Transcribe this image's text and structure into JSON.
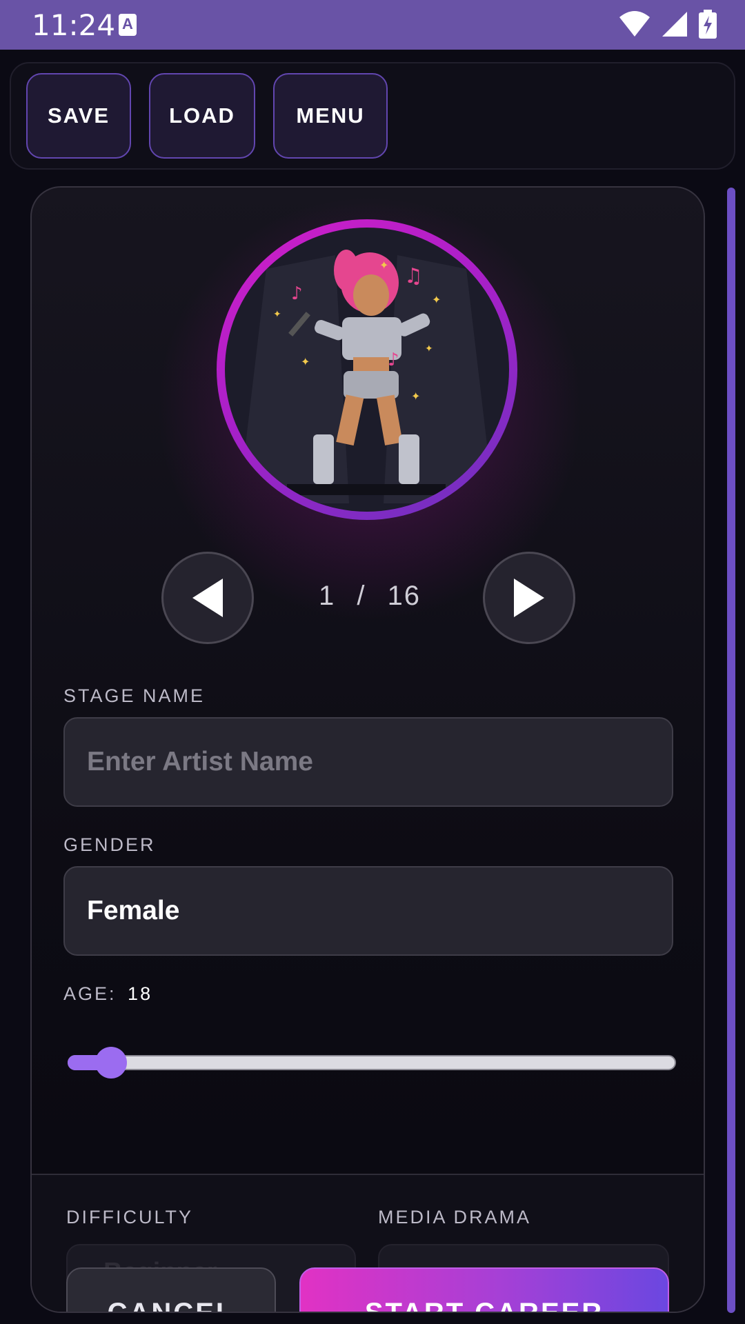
{
  "status_bar": {
    "time": "11:24",
    "notification_icon": "a-icon",
    "icons": [
      "wifi-icon",
      "signal-icon",
      "battery-charging-icon"
    ]
  },
  "toolbar": {
    "save_label": "SAVE",
    "load_label": "LOAD",
    "menu_label": "MENU"
  },
  "character": {
    "portrait": "pixel-art-pop-singer",
    "prev_icon": "triangle-left-icon",
    "next_icon": "triangle-right-icon",
    "index": "1",
    "separator": "/",
    "total": "16"
  },
  "form": {
    "stage_name_label": "STAGE NAME",
    "stage_name_placeholder": "Enter Artist Name",
    "stage_name_value": "",
    "gender_label": "GENDER",
    "gender_value": "Female",
    "age_label": "AGE:",
    "age_value": "18",
    "age_slider_fraction": 0.0
  },
  "settings": {
    "difficulty_label": "DIFFICULTY",
    "difficulty_value": "Beginner",
    "media_drama_label": "MEDIA DRAMA"
  },
  "actions": {
    "cancel_label": "CANCEL",
    "start_label": "START CAREER"
  },
  "colors": {
    "status_bar": "#6953a6",
    "accent": "#9b6cf0",
    "portrait_ring": "#d21ec8",
    "start_gradient_start": "#e132c4",
    "start_gradient_end": "#6b47e0"
  }
}
